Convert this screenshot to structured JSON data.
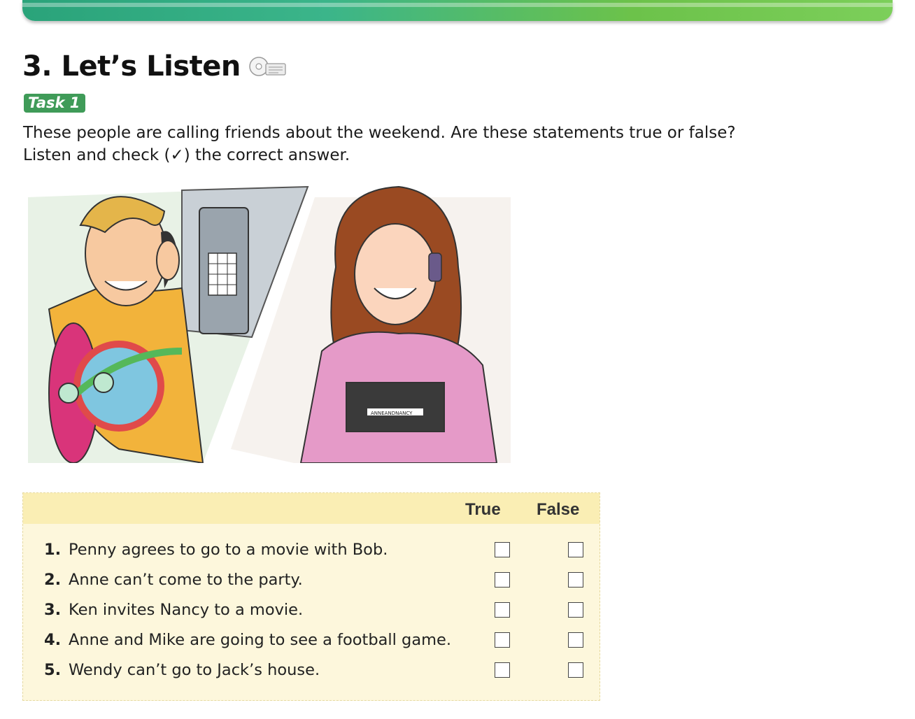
{
  "section": {
    "title": "3. Let’s Listen",
    "cd_icon": "cd-icon"
  },
  "task": {
    "label": "Task 1"
  },
  "instructions": {
    "line1": "These people are calling friends about the weekend. Are these statements true or false?",
    "line2": "Listen and check (✓) the correct answer."
  },
  "illustration": {
    "left": "man-with-skateboard-on-payphone",
    "right": "woman-on-cell-phone-holding-notebooks",
    "notebook_text": "ANNEANDNANCY"
  },
  "table": {
    "col_true": "True",
    "col_false": "False",
    "rows": [
      {
        "num": "1.",
        "text": "Penny agrees to go to a movie with Bob."
      },
      {
        "num": "2.",
        "text": "Anne can’t come to the party."
      },
      {
        "num": "3.",
        "text": "Ken invites Nancy to a movie."
      },
      {
        "num": "4.",
        "text": "Anne and Mike are going to see a football game."
      },
      {
        "num": "5.",
        "text": "Wendy can’t go to Jack’s house."
      }
    ]
  },
  "colors": {
    "banner": "#3bb58a",
    "task_badge": "#3f9b58",
    "table_bg": "#fdf7dc",
    "table_header": "#faeeb4"
  }
}
